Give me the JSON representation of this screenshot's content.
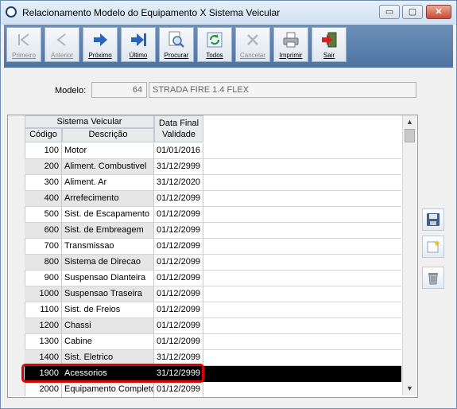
{
  "window": {
    "title": "Relacionamento Modelo do Equipamento X Sistema Veicular"
  },
  "title_buttons": {
    "minimize": "▭",
    "maximize": "▢",
    "close": "✕"
  },
  "toolbar": {
    "buttons": [
      {
        "label": "Primeiro",
        "icon": "first-record-icon",
        "enabled": false
      },
      {
        "label": "Anterior",
        "icon": "previous-record-icon",
        "enabled": false
      },
      {
        "label": "Próximo",
        "icon": "next-record-icon",
        "enabled": true
      },
      {
        "label": "Último",
        "icon": "last-record-icon",
        "enabled": true
      },
      {
        "label": "Procurar",
        "icon": "search-icon",
        "enabled": true
      },
      {
        "label": "Todos",
        "icon": "refresh-icon",
        "enabled": true
      },
      {
        "label": "Cancelar",
        "icon": "cancel-icon",
        "enabled": false
      },
      {
        "label": "Imprimir",
        "icon": "printer-icon",
        "enabled": true
      },
      {
        "label": "Sair",
        "icon": "exit-icon",
        "enabled": true
      }
    ]
  },
  "modelo": {
    "label": "Modelo:",
    "code": "64",
    "name": "STRADA FIRE 1.4 FLEX"
  },
  "grid": {
    "group_header": "Sistema Veicular",
    "col_code": "Código",
    "col_desc": "Descrição",
    "col_date_1": "Data Final",
    "col_date_2": "Validade",
    "rows": [
      {
        "code": "100",
        "desc": "Motor",
        "date": "01/01/2016",
        "shaded": false
      },
      {
        "code": "200",
        "desc": "Aliment. Combustivel",
        "date": "31/12/2999",
        "shaded": true
      },
      {
        "code": "300",
        "desc": "Aliment. Ar",
        "date": "31/12/2020",
        "shaded": false
      },
      {
        "code": "400",
        "desc": "Arrefecimento",
        "date": "01/12/2099",
        "shaded": true
      },
      {
        "code": "500",
        "desc": "Sist. de Escapamento",
        "date": "01/12/2099",
        "shaded": false
      },
      {
        "code": "600",
        "desc": "Sist. de Embreagem",
        "date": "01/12/2099",
        "shaded": true
      },
      {
        "code": "700",
        "desc": "Transmissao",
        "date": "01/12/2099",
        "shaded": false
      },
      {
        "code": "800",
        "desc": "Sistema de Direcao",
        "date": "01/12/2099",
        "shaded": true
      },
      {
        "code": "900",
        "desc": "Suspensao Dianteira",
        "date": "01/12/2099",
        "shaded": false
      },
      {
        "code": "1000",
        "desc": "Suspensao Traseira",
        "date": "01/12/2099",
        "shaded": true
      },
      {
        "code": "1100",
        "desc": "Sist. de Freios",
        "date": "01/12/2099",
        "shaded": false
      },
      {
        "code": "1200",
        "desc": "Chassi",
        "date": "01/12/2099",
        "shaded": true
      },
      {
        "code": "1300",
        "desc": "Cabine",
        "date": "01/12/2099",
        "shaded": false
      },
      {
        "code": "1400",
        "desc": "Sist. Eletrico",
        "date": "31/12/2099",
        "shaded": true
      },
      {
        "code": "1900",
        "desc": "Acessorios",
        "date": "31/12/2999",
        "shaded": false,
        "selected": true
      },
      {
        "code": "2000",
        "desc": "Equipamento Completo",
        "date": "01/12/2099",
        "shaded": false
      }
    ]
  },
  "side_buttons": [
    {
      "icon": "save-icon"
    },
    {
      "icon": "new-record-icon"
    },
    {
      "icon": "trash-icon"
    }
  ],
  "colors": {
    "toolbar": "#5a7fac",
    "selected_row": "#000000",
    "highlight": "#e00000"
  }
}
